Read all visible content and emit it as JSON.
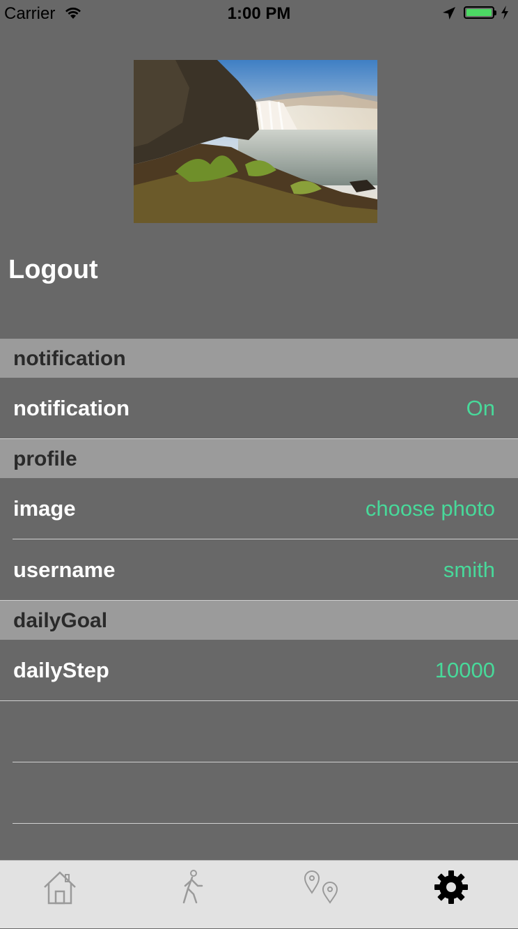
{
  "status_bar": {
    "carrier": "Carrier",
    "time": "1:00 PM",
    "battery_color": "#4cd964"
  },
  "profile_image": {
    "description_icon": "waterfall-photo"
  },
  "logout_label": "Logout",
  "sections": {
    "notification": {
      "header": "notification",
      "rows": [
        {
          "label": "notification",
          "value": "On"
        }
      ]
    },
    "profile": {
      "header": "profile",
      "rows": [
        {
          "label": "image",
          "value": "choose photo"
        },
        {
          "label": "username",
          "value": "smith"
        }
      ]
    },
    "dailyGoal": {
      "header": "dailyGoal",
      "rows": [
        {
          "label": "dailyStep",
          "value": "10000"
        }
      ]
    }
  },
  "accent_color": "#48d99a",
  "tab_bar": {
    "items": [
      {
        "icon": "home-icon",
        "selected": false
      },
      {
        "icon": "walking-icon",
        "selected": false
      },
      {
        "icon": "map-pins-icon",
        "selected": false
      },
      {
        "icon": "gear-icon",
        "selected": true
      }
    ]
  }
}
